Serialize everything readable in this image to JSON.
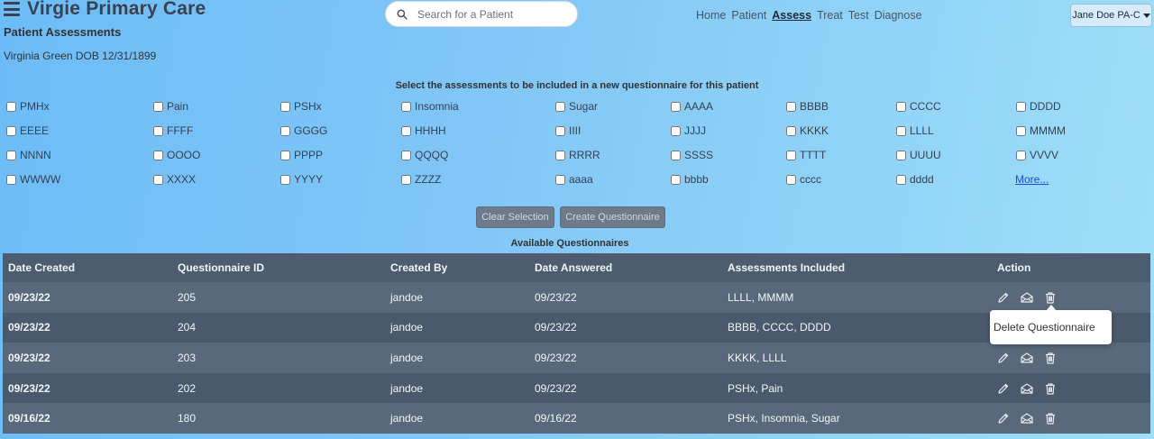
{
  "header": {
    "app_title": "Virgie Primary Care",
    "page_subtitle": "Patient Assessments",
    "patient_info": "Virginia Green DOB 12/31/1899"
  },
  "search": {
    "placeholder": "Search for a Patient",
    "value": ""
  },
  "nav": {
    "items": [
      {
        "label": "Home",
        "active": false
      },
      {
        "label": "Patient",
        "active": false
      },
      {
        "label": "Assess",
        "active": true
      },
      {
        "label": "Treat",
        "active": false
      },
      {
        "label": "Test",
        "active": false
      },
      {
        "label": "Diagnose",
        "active": false
      }
    ]
  },
  "user_menu": {
    "label": "Jane Doe PA-C"
  },
  "assessments": {
    "instructions": "Select the assessments to be included in a new questionnaire for this patient",
    "rows": [
      [
        "PMHx",
        "Pain",
        "PSHx",
        "Insomnia",
        "Sugar",
        "AAAA",
        "BBBB",
        "CCCC",
        "DDDD"
      ],
      [
        "EEEE",
        "FFFF",
        "GGGG",
        "HHHH",
        "IIII",
        "JJJJ",
        "KKKK",
        "LLLL",
        "MMMM"
      ],
      [
        "NNNN",
        "OOOO",
        "PPPP",
        "QQQQ",
        "RRRR",
        "SSSS",
        "TTTT",
        "UUUU",
        "VVVV"
      ],
      [
        "WWWW",
        "XXXX",
        "YYYY",
        "ZZZZ",
        "aaaa",
        "bbbb",
        "cccc",
        "dddd"
      ]
    ],
    "more_link": "More..."
  },
  "buttons": {
    "clear_selection": "Clear Selection",
    "create_questionnaire": "Create Questionnaire"
  },
  "questionnaires": {
    "title": "Available Questionnaires",
    "columns": [
      "Date Created",
      "Questionnaire ID",
      "Created By",
      "Date Answered",
      "Assessments Included",
      "Action"
    ],
    "rows": [
      {
        "date_created": "09/23/22",
        "id": "205",
        "created_by": "jandoe",
        "date_answered": "09/23/22",
        "assessments": "LLLL, MMMM"
      },
      {
        "date_created": "09/23/22",
        "id": "204",
        "created_by": "jandoe",
        "date_answered": "09/23/22",
        "assessments": "BBBB, CCCC, DDDD"
      },
      {
        "date_created": "09/23/22",
        "id": "203",
        "created_by": "jandoe",
        "date_answered": "09/23/22",
        "assessments": "KKKK, LLLL"
      },
      {
        "date_created": "09/23/22",
        "id": "202",
        "created_by": "jandoe",
        "date_answered": "09/23/22",
        "assessments": "PSHx, Pain"
      },
      {
        "date_created": "09/16/22",
        "id": "180",
        "created_by": "jandoe",
        "date_answered": "09/16/22",
        "assessments": "PSHx, Insomnia, Sugar"
      }
    ],
    "actions": [
      "pencil-icon",
      "envelope-open-icon",
      "trash-icon"
    ]
  },
  "tooltip": {
    "text": "Delete Questionnaire"
  },
  "colors": {
    "table_header": "#4e5c70",
    "row_odd": "#5a687c",
    "row_even": "#4b596d",
    "button": "#6c7a89",
    "link": "#1d4ed8"
  }
}
